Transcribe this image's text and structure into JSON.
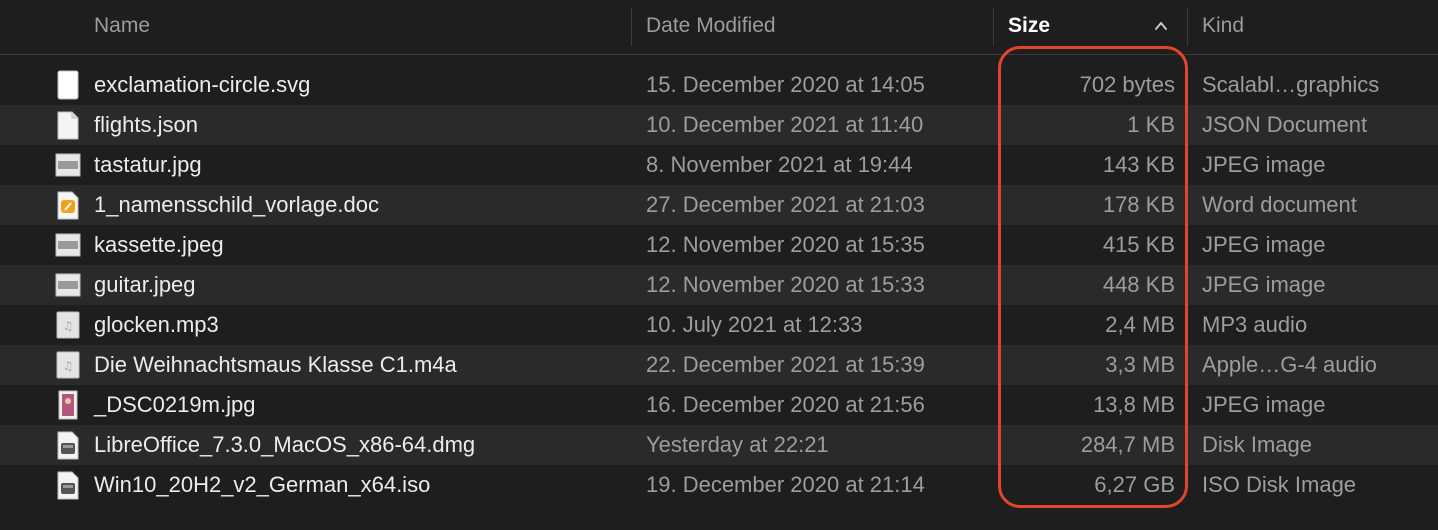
{
  "colors": {
    "background": "#1e1e1e",
    "row_alt": "#2a2a2a",
    "highlight": "#e2452c"
  },
  "header": {
    "name": "Name",
    "date_modified": "Date Modified",
    "size": "Size",
    "kind": "Kind",
    "sort_column": "size",
    "sort_direction": "ascending",
    "sort_icon": "chevron-up-icon"
  },
  "files": [
    {
      "name": "exclamation-circle.svg",
      "date": "15. December 2020 at 14:05",
      "size": "702 bytes",
      "kind": "Scalabl…graphics",
      "icon": "svg-file-icon"
    },
    {
      "name": "flights.json",
      "date": "10. December 2021 at 11:40",
      "size": "1 KB",
      "kind": "JSON Document",
      "icon": "json-file-icon"
    },
    {
      "name": "tastatur.jpg",
      "date": "8. November 2021 at 19:44",
      "size": "143 KB",
      "kind": "JPEG image",
      "icon": "image-thumbnail-icon"
    },
    {
      "name": "1_namensschild_vorlage.doc",
      "date": "27. December 2021 at 21:03",
      "size": "178 KB",
      "kind": "Word document",
      "icon": "word-document-icon"
    },
    {
      "name": "kassette.jpeg",
      "date": "12. November 2020 at 15:35",
      "size": "415 KB",
      "kind": "JPEG image",
      "icon": "image-thumbnail-icon"
    },
    {
      "name": "guitar.jpeg",
      "date": "12. November 2020 at 15:33",
      "size": "448 KB",
      "kind": "JPEG image",
      "icon": "image-thumbnail-icon"
    },
    {
      "name": "glocken.mp3",
      "date": "10. July 2021 at 12:33",
      "size": "2,4 MB",
      "kind": "MP3 audio",
      "icon": "audio-file-icon"
    },
    {
      "name": "Die Weihnachtsmaus Klasse C1.m4a",
      "date": "22. December 2021 at 15:39",
      "size": "3,3 MB",
      "kind": "Apple…G-4 audio",
      "icon": "audio-file-icon"
    },
    {
      "name": "_DSC0219m.jpg",
      "date": "16. December 2020 at 21:56",
      "size": "13,8 MB",
      "kind": "JPEG image",
      "icon": "photo-thumbnail-icon"
    },
    {
      "name": "LibreOffice_7.3.0_MacOS_x86-64.dmg",
      "date": "Yesterday at 22:21",
      "size": "284,7 MB",
      "kind": "Disk Image",
      "icon": "disk-image-icon"
    },
    {
      "name": "Win10_20H2_v2_German_x64.iso",
      "date": "19. December 2020 at 21:14",
      "size": "6,27 GB",
      "kind": "ISO Disk Image",
      "icon": "disk-image-icon"
    }
  ]
}
